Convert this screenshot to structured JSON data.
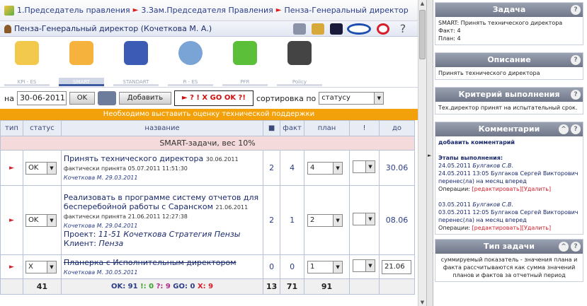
{
  "breadcrumb": {
    "items": [
      "1.Председатель правления",
      "3.Зам.Председателя Правления",
      "Пенза-Генеральный директор"
    ]
  },
  "header": {
    "title": "Пенза-Генеральный директор  (Кочеткова М. А.)"
  },
  "modules": [
    {
      "label": "KPI - ES",
      "icon": "warning-chart-icon"
    },
    {
      "label": "SMART",
      "icon": "folder-icon"
    },
    {
      "label": "STANDART",
      "icon": "goal-icon"
    },
    {
      "label": "R - ES",
      "icon": "rating-icon"
    },
    {
      "label": "PFR",
      "icon": "money-icon"
    },
    {
      "label": "Policy",
      "icon": "graduation-icon"
    }
  ],
  "controls": {
    "date_prefix": "на",
    "date": "30-06-2011",
    "ok": "OK",
    "add": "Добавить",
    "filter": "► ? ! X GO OK ?!",
    "sort_label": "сортировка по",
    "sort_value": "статусу"
  },
  "warning": "Необходимо выставить оценку технической поддержки",
  "table": {
    "headers": {
      "type": "тип",
      "status": "статус",
      "name": "название",
      "comments": "",
      "fact": "факт",
      "plan": "план",
      "flag": "!",
      "due": "до"
    },
    "section": "SMART-задачи, вес 10%",
    "rows": [
      {
        "status": "OK",
        "title": "Принять технического директора",
        "date": "30.06.2011",
        "accepted": "фактически принята 05.07.2011 11:51:30",
        "author": "Кочеткова М. 29.03.2011",
        "project": "",
        "client": "",
        "comments": "2",
        "fact": "4",
        "plan": "4",
        "due": "30.06"
      },
      {
        "status": "OK",
        "title": "Реализовать в программе систему отчетов для бесперебойной работы с Саранском",
        "date": "21.06.2011",
        "accepted": "фактически принята 21.06.2011 12:27:38",
        "author": "Кочеткова М. 29.04.2011",
        "project_label": "Проект:",
        "project": "11-51 Кочеткова Стратегия Пензы",
        "client_label": "Клиент:",
        "client": "Пенза",
        "comments": "2",
        "fact": "1",
        "plan": "2",
        "due": "08.06"
      },
      {
        "status": "X",
        "title": "Планерка с Исполнительным директором",
        "date": "",
        "accepted": "",
        "author": "Кочеткова М. 30.05.2011",
        "project": "",
        "client": "",
        "comments": "0",
        "fact": "0",
        "plan": "1",
        "due": "21.06"
      }
    ],
    "totals": {
      "count": "41",
      "stats_ok": "OK: 91",
      "stats_ex": "!: 0",
      "stats_q": "?: 9",
      "stats_go": "GO: 0",
      "stats_x": "X: 9",
      "comments": "13",
      "fact": "71",
      "plan": "91"
    }
  },
  "panel": {
    "task": {
      "title": "Задача",
      "line1": "SMART: Принять технического директора",
      "line2": "Факт: 4",
      "line3": "План: 4"
    },
    "desc": {
      "title": "Описание",
      "text": "Принять технического директора"
    },
    "crit": {
      "title": "Критерий выполнения",
      "text": "Тех.директор принят на испытательный срок."
    },
    "comm": {
      "title": "Комментарии",
      "add": "добавить комментарий",
      "stages": "Этапы выполнения:",
      "e1_date": "24.05.2011",
      "e1_author": "Булгаков С.В.",
      "e1_text": "24.05.2011 13:05 Булгаков Сергей Викторович перенес(ла) на месяц вперед",
      "e2_date": "03.05.2011",
      "e2_author": "Булгаков С.В.",
      "e2_text": "03.05.2011 12:05 Булгаков Сергей Викторович перенес(ла) на месяц вперед",
      "ops": "Операции:",
      "edit": "[редактировать]",
      "del": "[Удалить]"
    },
    "type": {
      "title": "Тип задачи",
      "text": "суммируемый показатель - значения плана и факта рассчитываются как сумма значений планов и фактов за отчетный период"
    }
  }
}
